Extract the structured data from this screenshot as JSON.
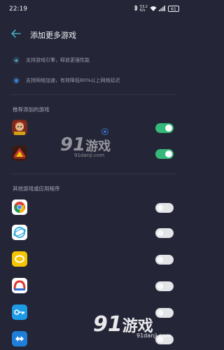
{
  "status": {
    "time": "22:19",
    "net_speed": "53.2",
    "net_unit": "K/s",
    "battery": "61"
  },
  "header": {
    "title": "添加更多游戏"
  },
  "features": [
    {
      "icon": "speaker-icon",
      "text": "支持游戏引擎，释放更强性能"
    },
    {
      "icon": "shield-icon",
      "text": "支持网络加速，有效降低80%以上网络延迟"
    }
  ],
  "recommended": {
    "title": "推荐添加的游戏",
    "items": [
      {
        "icon": "game-icon-1",
        "enabled": true
      },
      {
        "icon": "game-icon-2",
        "enabled": true
      }
    ]
  },
  "others": {
    "title": "其他游戏或应用程序",
    "items": [
      {
        "icon": "chrome-icon",
        "enabled": false
      },
      {
        "icon": "browser-icon",
        "enabled": false
      },
      {
        "icon": "yellow-app-icon",
        "enabled": false
      },
      {
        "icon": "red-app-icon",
        "enabled": false
      },
      {
        "icon": "key-app-icon",
        "enabled": false
      },
      {
        "icon": "remote-app-icon",
        "enabled": false
      }
    ]
  },
  "watermark": {
    "brand_num": "9",
    "brand_num2": "1",
    "brand_text": "游戏",
    "url": "91danji.com"
  },
  "colors": {
    "background": "#242536",
    "toggle_on": "#35b879",
    "toggle_off": "#e3e4e8",
    "accent": "#3a7bd5"
  }
}
